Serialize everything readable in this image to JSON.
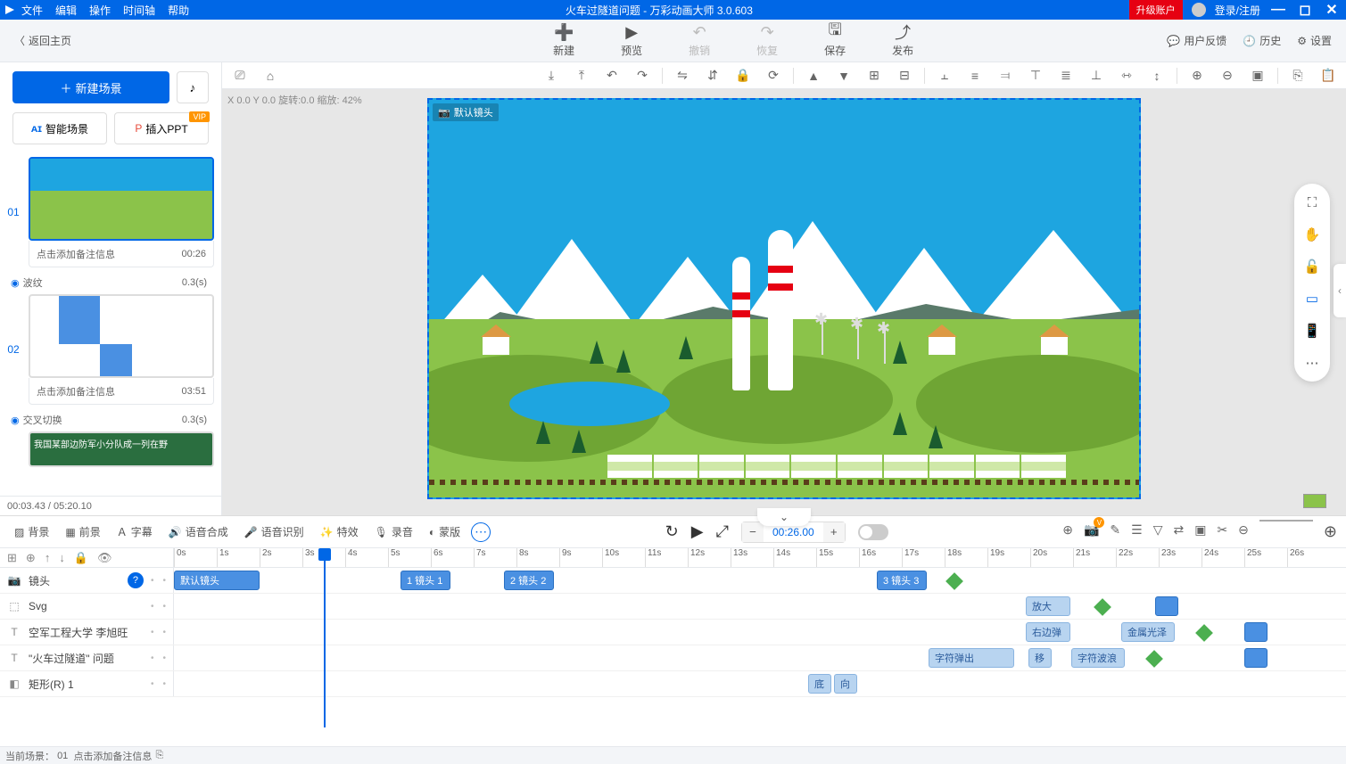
{
  "app": {
    "title_doc": "火车过隧道问题",
    "title_app": "万彩动画大师 3.0.603",
    "upgrade": "升级账户",
    "login": "登录/注册"
  },
  "menu": {
    "file": "文件",
    "edit": "编辑",
    "manipulate": "操作",
    "timeline": "时间轴",
    "help": "帮助"
  },
  "topbar": {
    "back": "返回主页",
    "new": "新建",
    "preview": "预览",
    "undo": "撤销",
    "redo": "恢复",
    "save": "保存",
    "publish": "发布",
    "feedback": "用户反馈",
    "history": "历史",
    "settings": "设置"
  },
  "left": {
    "new_scene": "新建场景",
    "smart_scene": "智能场景",
    "insert_ppt": "插入PPT",
    "vip": "VIP",
    "scene1": {
      "num": "01",
      "note": "点击添加备注信息",
      "dur": "00:26",
      "trans": "波纹",
      "trans_dur": "0.3(s)"
    },
    "scene2": {
      "num": "02",
      "note": "点击添加备注信息",
      "dur": "03:51",
      "trans": "交叉切换",
      "trans_dur": "0.3(s)"
    },
    "scene3_text": "我国某部边防军小分队成一列在野",
    "footer_time": "00:03.43 / 05:20.10"
  },
  "canvas": {
    "info": "X 0.0 Y 0.0 旋转:0.0 缩放: 42%",
    "camera_label": "默认镜头"
  },
  "timeline": {
    "tabs": {
      "bg": "背景",
      "fg": "前景",
      "subtitle": "字幕",
      "tts": "语音合成",
      "asr": "语音识别",
      "fx": "特效",
      "record": "录音",
      "mask": "蒙版"
    },
    "current_time": "00:26.00",
    "ticks": [
      "0s",
      "1s",
      "2s",
      "3s",
      "4s",
      "5s",
      "6s",
      "7s",
      "8s",
      "9s",
      "10s",
      "11s",
      "12s",
      "13s",
      "14s",
      "15s",
      "16s",
      "17s",
      "18s",
      "19s",
      "20s",
      "21s",
      "22s",
      "23s",
      "24s",
      "25s",
      "26s"
    ],
    "tracks": {
      "camera": {
        "name": "镜头",
        "clip_default": "默认镜头",
        "clip1": "1 镜头 1",
        "clip2": "2 镜头 2",
        "clip3": "3 镜头 3"
      },
      "svg": {
        "name": "Svg",
        "zoom": "放大"
      },
      "text1": {
        "name": "空军工程大学 李旭旺",
        "clip_a": "右边弹",
        "clip_b": "金属光泽"
      },
      "text2": {
        "name": "\"火车过隧道\" 问题",
        "clip_a": "字符弹出",
        "clip_m": "移",
        "clip_b": "字符波浪"
      },
      "rect": {
        "name": "矩形(R) 1",
        "clip_a": "底",
        "clip_b": "向"
      }
    }
  },
  "status": {
    "current_scene_label": "当前场景：",
    "current_scene_num": "01",
    "note_hint": "点击添加备注信息"
  }
}
